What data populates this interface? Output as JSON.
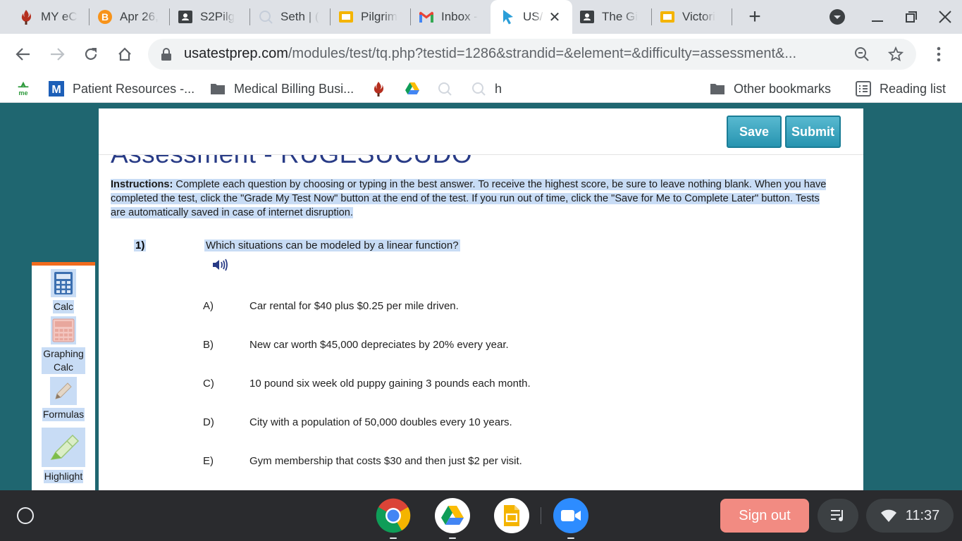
{
  "browser": {
    "tabs": [
      {
        "title": "MY eC",
        "icon": "flame-torch-icon"
      },
      {
        "title": "Apr 26,",
        "icon": "bitcoin-icon"
      },
      {
        "title": "S2Pilg",
        "icon": "classroom-icon"
      },
      {
        "title": "Seth | (",
        "icon": "search-loading-icon"
      },
      {
        "title": "Pilgrim",
        "icon": "slides-icon"
      },
      {
        "title": "Inbox -",
        "icon": "gmail-icon"
      },
      {
        "title": "US/",
        "icon": "cursor-arrow-icon",
        "active": true
      },
      {
        "title": "The Gi",
        "icon": "classroom-icon"
      },
      {
        "title": "Victori",
        "icon": "slides-icon"
      }
    ],
    "url_host": "usatestprep.com",
    "url_path": "/modules/test/tq.php?testid=1286&strandid=&element=&difficulty=assessment&...",
    "bookmarks": [
      {
        "label": "",
        "icon": "me-logo-icon"
      },
      {
        "label": "Patient Resources -...",
        "icon": "m-logo-icon"
      },
      {
        "label": "Medical Billing Busi...",
        "icon": "folder-icon"
      },
      {
        "label": "",
        "icon": "flame-torch-icon"
      },
      {
        "label": "",
        "icon": "google-drive-icon"
      },
      {
        "label": "",
        "icon": "search-loading-icon"
      },
      {
        "label": "",
        "icon": "search-loading-icon"
      },
      {
        "label": "h",
        "icon": ""
      }
    ],
    "other_bookmarks": "Other bookmarks",
    "reading_list": "Reading list"
  },
  "page": {
    "save_label": "Save",
    "submit_label": "Submit",
    "title": "Assessment - RUGESUCUDO",
    "instructions_label": "Instructions:",
    "instructions_text": " Complete each question by choosing or typing in the best answer. To receive the highest score, be sure to leave nothing blank. When you have completed the test, click the \"Grade My Test Now\" button at the end of the test. If you run out of time, click the \"Save for Me to Complete Later\" button. Tests are automatically saved in case of internet disruption.",
    "question_number": "1)",
    "question_text": "Which situations can be modeled by a linear function?",
    "choices": [
      {
        "letter": "A)",
        "text": "Car rental for $40 plus $0.25 per mile driven."
      },
      {
        "letter": "B)",
        "text": "New car worth $45,000 depreciates by 20% every year."
      },
      {
        "letter": "C)",
        "text": "10 pound six week old puppy gaining 3 pounds each month."
      },
      {
        "letter": "D)",
        "text": "City with a population of 50,000 doubles every 10 years."
      },
      {
        "letter": "E)",
        "text": "Gym membership that costs $30 and then just $2 per visit."
      }
    ],
    "tools": [
      {
        "label": "Calc",
        "icon": "calculator-icon"
      },
      {
        "label": "Graphing Calc",
        "icon": "graphing-calculator-icon"
      },
      {
        "label": "Formulas",
        "icon": "pencil-icon"
      },
      {
        "label": "Highlight",
        "icon": "highlighter-icon"
      }
    ]
  },
  "shelf": {
    "apps": [
      "chrome-icon",
      "google-drive-icon",
      "google-slides-icon",
      "zoom-icon"
    ],
    "sign_out": "Sign out",
    "time": "11:37"
  },
  "colors": {
    "page_background": "#1f6670",
    "title_color": "#283b86",
    "button_blue": "#2794b0",
    "tools_accent": "#f26b1d",
    "selection_highlight": "#c8dcf5",
    "sign_out": "#f28b82"
  }
}
